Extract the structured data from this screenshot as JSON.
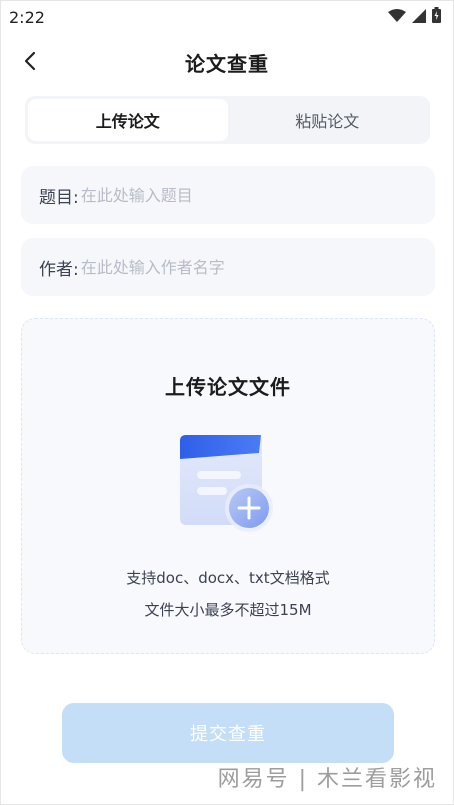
{
  "status_bar": {
    "time": "2:22"
  },
  "header": {
    "title": "论文查重"
  },
  "tabs": [
    {
      "label": "上传论文",
      "active": true
    },
    {
      "label": "粘贴论文",
      "active": false
    }
  ],
  "form": {
    "title_label": "题目:",
    "title_placeholder": "在此处输入题目",
    "author_label": "作者:",
    "author_placeholder": "在此处输入作者名字"
  },
  "upload": {
    "title": "上传论文文件",
    "hint_formats": "支持doc、docx、txt文档格式",
    "hint_size": "文件大小最多不超过15M"
  },
  "submit_label": "提交查重",
  "watermark": "网易号 | 木兰看影视",
  "colors": {
    "accent": "#3d6df2",
    "submit_disabled": "#c3def6",
    "field_bg": "#f5f7fa",
    "tab_bg": "#f2f4f7"
  }
}
